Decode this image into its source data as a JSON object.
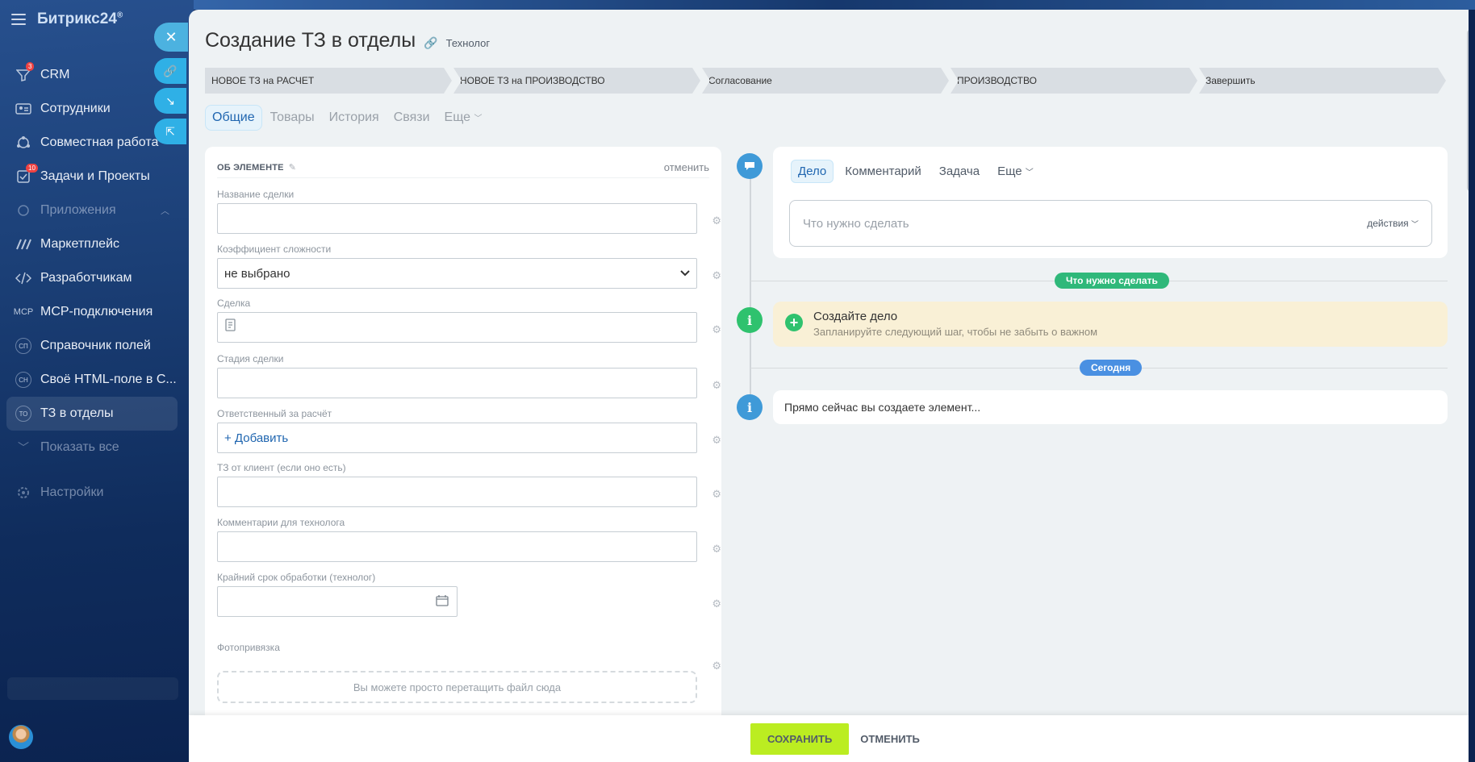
{
  "sidebar": {
    "logo": "Битрикс24",
    "logo_mark": "®",
    "items": [
      {
        "label": "CRM",
        "icon": "filter-icon",
        "badge": "3"
      },
      {
        "label": "Сотрудники",
        "icon": "employees-icon"
      },
      {
        "label": "Совместная работа",
        "icon": "collab-icon"
      },
      {
        "label": "Задачи и Проекты",
        "icon": "tasks-icon",
        "badge": "10"
      },
      {
        "label": "Приложения",
        "icon": "apps-icon"
      },
      {
        "label": "Маркетплейс",
        "icon": "marketplace-icon"
      },
      {
        "label": "Разработчикам",
        "icon": "code-icon"
      },
      {
        "label": "MCP-подключения",
        "icon": "mcp-icon"
      },
      {
        "label": "Справочник полей",
        "icon": "fields-icon",
        "abbr": "СП"
      },
      {
        "label": "Своё HTML-поле в С...",
        "icon": "html-field-icon",
        "abbr": "СН"
      },
      {
        "label": "ТЗ в отделы",
        "icon": "tz-icon",
        "abbr": "ТО"
      },
      {
        "label": "Показать все",
        "icon": "chevron-down-icon"
      },
      {
        "label": "Настройки",
        "icon": "settings-icon"
      }
    ]
  },
  "header": {
    "title": "Создание ТЗ в отделы",
    "tag": "Технолог"
  },
  "stages": [
    "НОВОЕ ТЗ на РАСЧЕТ",
    "НОВОЕ ТЗ на ПРОИЗВОДСТВО",
    "Согласование",
    "ПРОИЗВОДСТВО",
    "Завершить"
  ],
  "tabs": [
    "Общие",
    "Товары",
    "История",
    "Связи",
    "Еще"
  ],
  "form": {
    "section_title": "ОБ ЭЛЕМЕНТЕ",
    "cancel": "отменить",
    "fields": {
      "deal_name": {
        "label": "Название сделки",
        "value": ""
      },
      "complexity": {
        "label": "Коэффициент сложности",
        "value": "не выбрано"
      },
      "deal": {
        "label": "Сделка",
        "value": ""
      },
      "stage": {
        "label": "Стадия сделки",
        "value": ""
      },
      "responsible": {
        "label": "Ответственный за расчёт",
        "value": "+ Добавить"
      },
      "client_tz": {
        "label": "ТЗ от клиент (если оно есть)",
        "value": ""
      },
      "comments": {
        "label": "Комментарии для технолога",
        "value": ""
      },
      "deadline": {
        "label": "Крайний срок обработки (технолог)",
        "value": ""
      },
      "photo": {
        "label": "Фотопривязка",
        "dropzone": "Вы можете просто перетащить файл сюда"
      }
    }
  },
  "activity": {
    "tabs": [
      "Дело",
      "Комментарий",
      "Задача",
      "Еще"
    ],
    "placeholder": "Что нужно сделать",
    "actions": "действия"
  },
  "timeline": {
    "todo_pill": "Что нужно сделать",
    "today_pill": "Сегодня",
    "notice_title": "Создайте дело",
    "notice_sub": "Запланируйте следующий шаг, чтобы не забыть о важном",
    "info_text": "Прямо сейчас вы создаете элемент..."
  },
  "footer": {
    "save": "СОХРАНИТЬ",
    "cancel": "ОТМЕНИТЬ"
  },
  "colors": {
    "accent": "#2066b0",
    "save_button": "#bbed21",
    "todo_pill": "#2fb87a",
    "today_pill": "#4a90e2",
    "timeline_info": "#3f9ad8",
    "timeline_green": "#2fc26e",
    "notice_bg": "#f9f0d6"
  }
}
